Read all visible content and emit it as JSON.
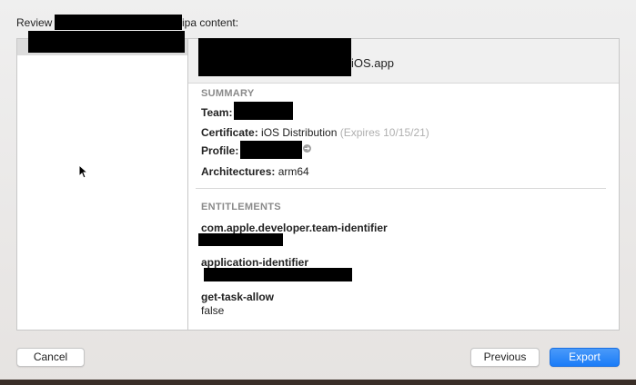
{
  "title": {
    "prefix": "Review",
    "suffix": "ipa content:"
  },
  "app": {
    "name_suffix": "iOS.app"
  },
  "summary": {
    "header": "SUMMARY",
    "team_label": "Team:",
    "certificate_label": "Certificate:",
    "certificate_value": "iOS Distribution",
    "certificate_expiry": "(Expires 10/15/21)",
    "profile_label": "Profile:",
    "architectures_label": "Architectures:",
    "architectures_value": "arm64"
  },
  "entitlements": {
    "header": "ENTITLEMENTS",
    "items": [
      {
        "key": "com.apple.developer.team-identifier"
      },
      {
        "key": "application-identifier"
      },
      {
        "key": "get-task-allow",
        "value": "false"
      }
    ]
  },
  "buttons": {
    "cancel": "Cancel",
    "previous": "Previous",
    "export": "Export"
  },
  "colors": {
    "accent": "#1a7cf8"
  }
}
